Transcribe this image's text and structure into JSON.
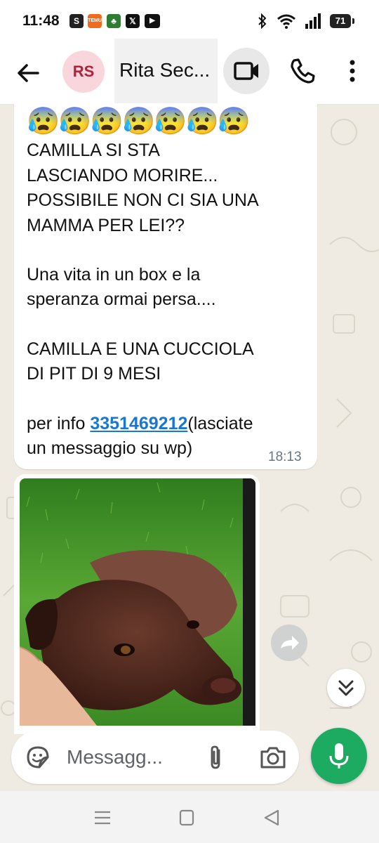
{
  "status": {
    "time": "11:48",
    "apps": [
      "S",
      "TEMU",
      "♣",
      "𝕏",
      "▶"
    ],
    "battery": "71"
  },
  "header": {
    "avatar_initials": "RS",
    "contact_name": "Rita Sec..."
  },
  "message": {
    "emojis": "😰😰😰😰😰😰😰",
    "lines": [
      "CAMILLA  SI STA",
      "LASCIANDO MORIRE...",
      "POSSIBILE NON CI SIA UNA",
      "MAMMA PER LEI??",
      "Una vita in un box e la",
      "speranza ormai persa....",
      "CAMILLA E UNA CUCCIOLA",
      "DI PIT DI 9 MESI",
      "per info ",
      "(lasciate",
      "un messaggio su wp)"
    ],
    "phone_link": "3351469212",
    "time": "18:13"
  },
  "composer": {
    "placeholder": "Messagg..."
  },
  "colors": {
    "accent_green": "#1daa61",
    "link_blue": "#1976d2",
    "chat_bg": "#efeae2"
  },
  "icons": [
    "back-arrow-icon",
    "video-call-icon",
    "phone-icon",
    "more-vert-icon",
    "forward-icon",
    "chevron-double-down-icon",
    "sticker-icon",
    "paperclip-icon",
    "camera-icon",
    "mic-icon"
  ]
}
